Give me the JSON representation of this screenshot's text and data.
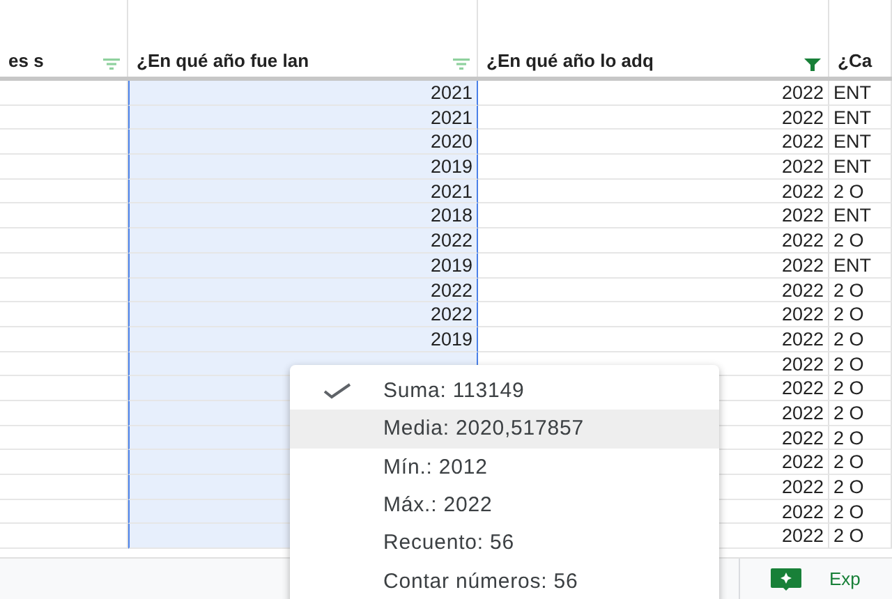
{
  "columns": [
    {
      "header": "es s",
      "filter_active": false,
      "selected": false
    },
    {
      "header": "¿En qué año fue lan",
      "filter_active": false,
      "selected": true
    },
    {
      "header": "¿En qué año lo adq",
      "filter_active": true,
      "selected": false
    },
    {
      "header": "¿Ca",
      "selected": false
    }
  ],
  "rows": [
    [
      "",
      "2021",
      "2022",
      "ENT"
    ],
    [
      "",
      "2021",
      "2022",
      "ENT"
    ],
    [
      "",
      "2020",
      "2022",
      "ENT"
    ],
    [
      "",
      "2019",
      "2022",
      "ENT"
    ],
    [
      "",
      "2021",
      "2022",
      "2 O"
    ],
    [
      "",
      "2018",
      "2022",
      "ENT"
    ],
    [
      "",
      "2022",
      "2022",
      "2 O"
    ],
    [
      "",
      "2019",
      "2022",
      "ENT"
    ],
    [
      "",
      "2022",
      "2022",
      "2 O"
    ],
    [
      "",
      "2022",
      "2022",
      "2 O"
    ],
    [
      "",
      "2019",
      "2022",
      "2 O"
    ],
    [
      "",
      "",
      "2022",
      "2 O"
    ],
    [
      "",
      "",
      "2022",
      "2 O"
    ],
    [
      "",
      "",
      "2022",
      "2 O"
    ],
    [
      "",
      "",
      "2022",
      "2 O"
    ],
    [
      "",
      "",
      "2022",
      "2 O"
    ],
    [
      "",
      "",
      "2022",
      "2 O"
    ],
    [
      "",
      "",
      "2022",
      "2 O"
    ],
    [
      "",
      "",
      "2022",
      "2 O"
    ]
  ],
  "footer": {
    "explore_label": "Exp"
  },
  "summary_menu": [
    {
      "label": "Suma: 113149",
      "checked": true,
      "highlighted": false
    },
    {
      "label": "Media: 2020,517857",
      "checked": false,
      "highlighted": true
    },
    {
      "label": "Mín.: 2012",
      "checked": false,
      "highlighted": false
    },
    {
      "label": "Máx.: 2022",
      "checked": false,
      "highlighted": false
    },
    {
      "label": "Recuento: 56",
      "checked": false,
      "highlighted": false
    },
    {
      "label": "Contar números: 56",
      "checked": false,
      "highlighted": false
    }
  ]
}
